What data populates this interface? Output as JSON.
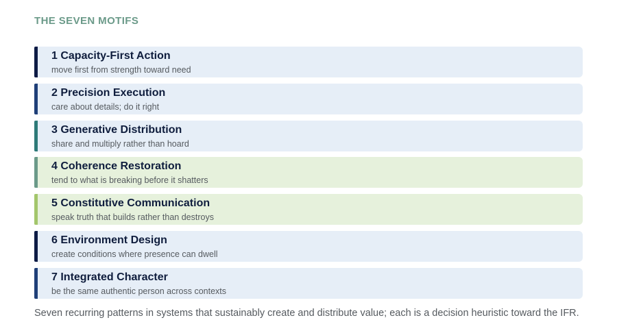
{
  "heading": "THE SEVEN MOTIFS",
  "motifs": [
    {
      "title": "1 Capacity-First Action",
      "description": "move first from strength toward need",
      "accent": "#0d1b45",
      "background": "#e6eef7"
    },
    {
      "title": "2 Precision Execution",
      "description": "care about details; do it right",
      "accent": "#1f3f78",
      "background": "#e6eef7"
    },
    {
      "title": "3 Generative Distribution",
      "description": "share and multiply rather than hoard",
      "accent": "#2e7a78",
      "background": "#e6eef7"
    },
    {
      "title": "4 Coherence Restoration",
      "description": "tend to what is breaking before it shatters",
      "accent": "#6b9a89",
      "background": "#e6f1dc"
    },
    {
      "title": "5 Constitutive Communication",
      "description": "speak truth that builds rather than destroys",
      "accent": "#a3c66b",
      "background": "#e6f1dc"
    },
    {
      "title": "6 Environment Design",
      "description": "create conditions where presence can dwell",
      "accent": "#0d1b45",
      "background": "#e6eef7"
    },
    {
      "title": "7 Integrated Character",
      "description": "be the same authentic person across contexts",
      "accent": "#1f3f78",
      "background": "#e6eef7"
    }
  ],
  "caption": "Seven recurring patterns in systems that sustainably create and distribute value; each is a decision heuristic toward the IFR."
}
